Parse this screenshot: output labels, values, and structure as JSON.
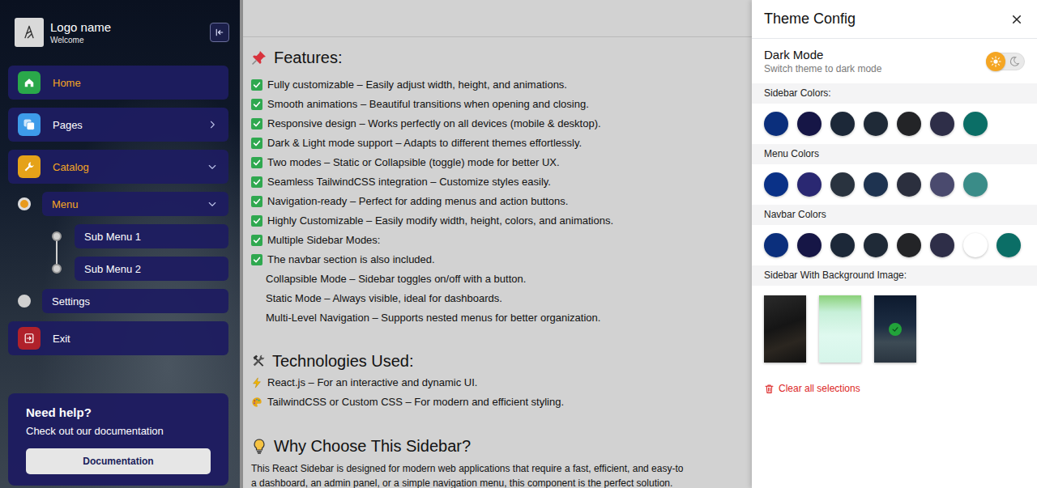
{
  "sidebar": {
    "logo": {
      "name": "Logo name",
      "subtitle": "Welcome"
    },
    "items": [
      {
        "label": "Home",
        "level": 0,
        "active": true,
        "has_children": false,
        "expanded": false,
        "color": "#2aa84a"
      },
      {
        "label": "Pages",
        "level": 0,
        "active": false,
        "has_children": true,
        "expanded": false,
        "color": "#3d9be9"
      },
      {
        "label": "Catalog",
        "level": 0,
        "active": true,
        "has_children": true,
        "expanded": true,
        "color": "#e5a219"
      },
      {
        "label": "Menu",
        "level": 1,
        "active": true,
        "has_children": true,
        "expanded": true
      },
      {
        "label": "Sub Menu 1",
        "level": 2,
        "active": false,
        "has_children": false,
        "expanded": false
      },
      {
        "label": "Sub Menu 2",
        "level": 2,
        "active": false,
        "has_children": false,
        "expanded": false
      },
      {
        "label": "Settings",
        "level": 1,
        "active": false,
        "has_children": false,
        "expanded": false
      },
      {
        "label": "Exit",
        "level": 0,
        "active": false,
        "has_children": false,
        "expanded": false,
        "color": "#b0212b"
      }
    ],
    "help": {
      "title": "Need help?",
      "text": "Check out our documentation",
      "button": "Documentation"
    }
  },
  "content": {
    "features": {
      "title": "Features:",
      "items": [
        {
          "text": "Fully customizable – Easily adjust width, height, and animations.",
          "checked": true
        },
        {
          "text": "Smooth animations – Beautiful transitions when opening and closing.",
          "checked": true
        },
        {
          "text": "Responsive design – Works perfectly on all devices (mobile & desktop).",
          "checked": true
        },
        {
          "text": "Dark & Light mode support – Adapts to different themes effortlessly.",
          "checked": true
        },
        {
          "text": "Two modes – Static or Collapsible (toggle) mode for better UX.",
          "checked": true
        },
        {
          "text": "Seamless TailwindCSS integration – Customize styles easily.",
          "checked": true
        },
        {
          "text": "Navigation-ready – Perfect for adding menus and action buttons.",
          "checked": true
        },
        {
          "text": "Highly Customizable – Easily modify width, height, colors, and animations.",
          "checked": true
        },
        {
          "text": "Multiple Sidebar Modes:",
          "checked": true
        },
        {
          "text": "The navbar section is also included.",
          "checked": true
        },
        {
          "text": "Collapsible Mode – Sidebar toggles on/off with a button.",
          "checked": false
        },
        {
          "text": "Static Mode – Always visible, ideal for dashboards.",
          "checked": false
        },
        {
          "text": "Multi-Level Navigation – Supports nested menus for better organization.",
          "checked": false
        }
      ]
    },
    "technologies": {
      "title": "Technologies Used:",
      "items": [
        "React.js – For an interactive and dynamic UI.",
        "TailwindCSS or Custom CSS – For modern and efficient styling."
      ]
    },
    "why": {
      "title": "Why Choose This Sidebar?",
      "lines": [
        "This React Sidebar is designed for modern web applications that require a fast, efficient, and easy-to",
        "a dashboard, an admin panel, or a simple navigation menu, this component is the perfect solution."
      ]
    }
  },
  "theme_panel": {
    "title": "Theme Config",
    "dark_mode": {
      "label": "Dark Mode",
      "description": "Switch theme to dark mode",
      "on": false
    },
    "groups": [
      {
        "label": "Sidebar Colors:",
        "swatches": [
          {
            "color": "#0b2f7c"
          },
          {
            "color": "#161646"
          },
          {
            "color": "#1c2838"
          },
          {
            "color": "#1f2a37"
          },
          {
            "color": "#232427"
          },
          {
            "color": "#2e2e48"
          },
          {
            "color": "#0b6e66"
          }
        ]
      },
      {
        "label": "Menu Colors",
        "swatches": [
          {
            "color": "#0a3187"
          },
          {
            "color": "#2a2872"
          },
          {
            "color": "#29333f"
          },
          {
            "color": "#1e3350"
          },
          {
            "color": "#2b2f3e"
          },
          {
            "color": "#4a4a6e"
          },
          {
            "color": "#3a8c88"
          }
        ]
      },
      {
        "label": "Navbar Colors",
        "swatches": [
          {
            "color": "#0b2f7c"
          },
          {
            "color": "#161646"
          },
          {
            "color": "#1c2838"
          },
          {
            "color": "#1f2a37"
          },
          {
            "color": "#232427"
          },
          {
            "color": "#2e2e48"
          },
          {
            "color": "#ffffff"
          },
          {
            "color": "#0b6e66"
          }
        ]
      }
    ],
    "backgrounds": {
      "label": "Sidebar With Background Image:",
      "images": [
        {
          "selected": false
        },
        {
          "selected": false
        },
        {
          "selected": true
        }
      ]
    },
    "clear": "Clear all selections"
  }
}
